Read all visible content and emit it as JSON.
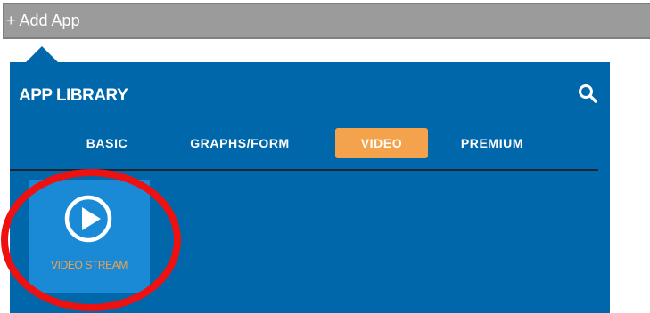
{
  "add_app": {
    "label": "+ Add App"
  },
  "library": {
    "title": "APP LIBRARY",
    "search_icon": "search-icon",
    "tabs": [
      {
        "label": "BASIC",
        "active": false
      },
      {
        "label": "GRAPHS/FORM",
        "active": false
      },
      {
        "label": "VIDEO",
        "active": true
      },
      {
        "label": "PREMIUM",
        "active": false
      }
    ],
    "apps": [
      {
        "label": "VIDEO STREAM",
        "icon": "play-circle-icon"
      }
    ]
  },
  "colors": {
    "panel": "#0067aa",
    "tile": "#1b8ad6",
    "accent": "#f4a24b",
    "add_bar": "#9b9b9b",
    "highlight": "#ee1111"
  }
}
